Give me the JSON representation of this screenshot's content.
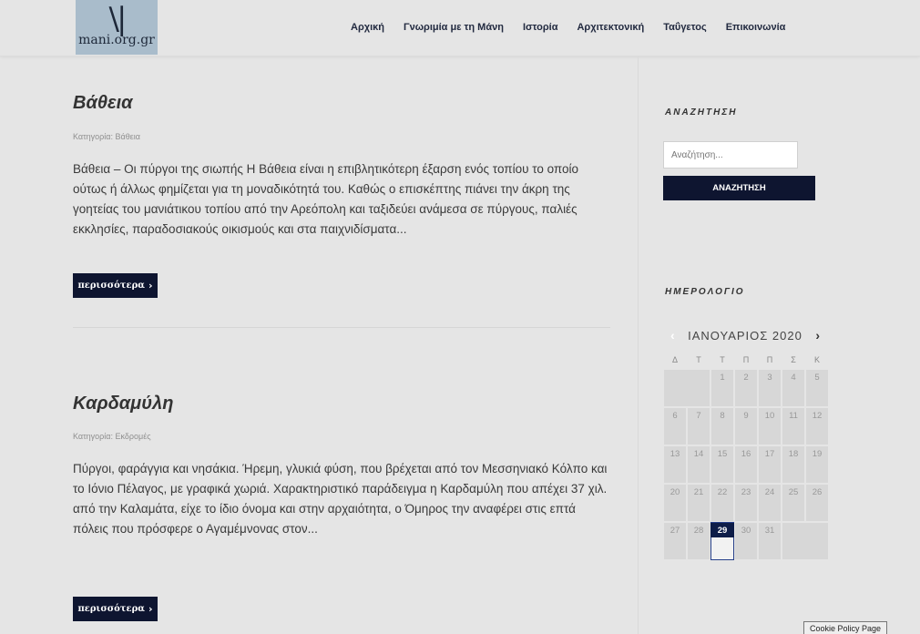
{
  "header": {
    "logo_mark": "\\|",
    "logo_text": "mani.org.gr",
    "nav": [
      "Αρχική",
      "Γνωριμία με τη Μάνη",
      "Ιστορία",
      "Αρχιτεκτονική",
      "Ταΰγετος",
      "Επικοινωνία"
    ]
  },
  "posts": [
    {
      "title": "Βάθεια",
      "category": "Κατηγορία: Βάθεια",
      "excerpt": "Βάθεια – Οι πύργοι της σιωπής Η Βάθεια είναι η επιβλητικότερη έξαρση ενός τοπίου το οποίο ούτως ή άλλως φημίζεται για τη μοναδικότητά του. Καθώς ο επισκέπτης πιάνει την άκρη της γοητείας του μανιάτικου τοπίου από την Αρεόπολη και ταξιδεύει ανάμεσα σε πύργους, παλιές εκκλησίες, παραδοσιακούς οικισμούς και στα παιχνιδίσματα...",
      "more_label": "περισσότερα"
    },
    {
      "title": "Καρδαμύλη",
      "category": "Κατηγορία: Εκδρομές",
      "excerpt": "Πύργοι, φαράγγια και νησάκια. Ήρεμη, γλυκιά φύση, που βρέχεται από τον Μεσσηνιακό Κόλπο και το Ιόνιο Πέλαγος, με γραφικά χωριά. Χαρακτηριστικό παράδειγμα η Καρδαμύλη που απέχει 37 χιλ. από την Καλαμάτα, είχε το ίδιο όνομα και στην αρχαιότητα, ο Όμηρος την αναφέρει στις επτά πόλεις που πρόσφερε ο Αγαμέμνονας στον...",
      "more_label": "περισσότερα"
    }
  ],
  "sidebar": {
    "search_title": "ΑΝΑΖΗΤΗΣΗ",
    "search_placeholder": "Αναζήτηση...",
    "search_button": "ΑΝΑΖΗΤΗΣΗ",
    "calendar_title": "ΗΜΕΡΟΛΟΓΙΟ",
    "calendar_month": "ΙΑΝΟΥΑΡΙΟΣ 2020",
    "calendar_dow": [
      "Δ",
      "Τ",
      "Τ",
      "Π",
      "Π",
      "Σ",
      "Κ"
    ],
    "calendar_weeks": [
      [
        "",
        "",
        "",
        "1",
        "2",
        "3",
        "4",
        "5"
      ],
      [
        "6",
        "7",
        "8",
        "9",
        "10",
        "11",
        "12"
      ],
      [
        "13",
        "14",
        "15",
        "16",
        "17",
        "18",
        "19"
      ],
      [
        "20",
        "21",
        "22",
        "23",
        "24",
        "25",
        "26"
      ],
      [
        "27",
        "28",
        "29",
        "30",
        "31"
      ]
    ],
    "today": "29"
  },
  "cookie_label": "Cookie Policy Page",
  "icons": {
    "more_chevron": "chevron-right-icon",
    "calendar_prev": "chevron-left-icon",
    "calendar_next": "chevron-right-icon"
  },
  "colors": {
    "accent": "#0e1530",
    "background": "#e5e5e5",
    "today": "#0e1d48"
  }
}
